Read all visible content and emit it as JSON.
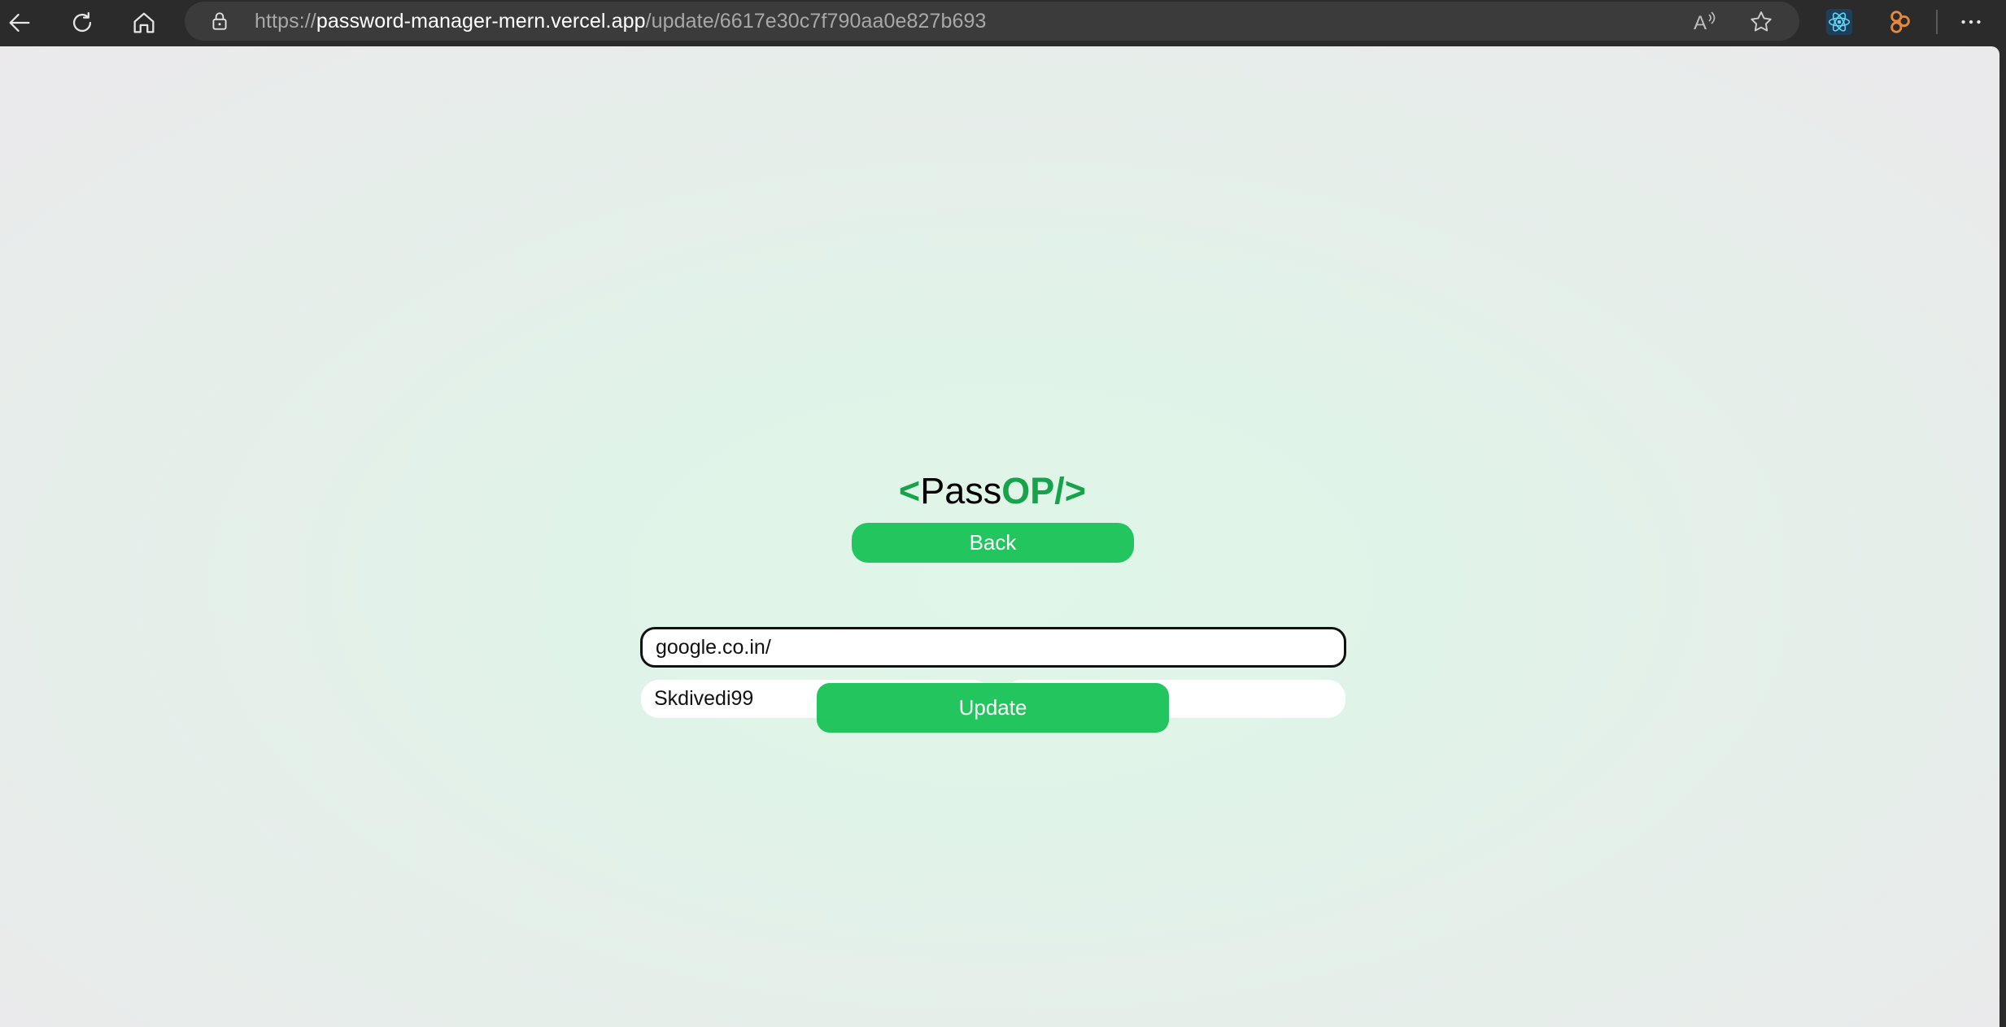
{
  "browser": {
    "url_scheme": "https://",
    "url_host": "password-manager-mern.vercel.app",
    "url_path": "/update/6617e30c7f790aa0e827b693",
    "icons": {
      "back": "back-arrow-icon",
      "refresh": "refresh-icon",
      "home": "home-icon",
      "lock": "lock-icon",
      "read_aloud": "read-aloud-icon",
      "favorite": "star-icon",
      "extension_react": "react-devtools-icon",
      "extension_other": "extension-icon",
      "menu": "more-menu-icon"
    }
  },
  "app": {
    "logo": {
      "open": "<",
      "pass": "Pass",
      "op": "OP/>"
    },
    "back_label": "Back",
    "update_label": "Update",
    "site_value": "google.co.in/",
    "username_value": "Skdivedi99",
    "password_value": "•••••••",
    "colors": {
      "accent": "#22c55e",
      "logo_green": "#16a34a"
    }
  }
}
